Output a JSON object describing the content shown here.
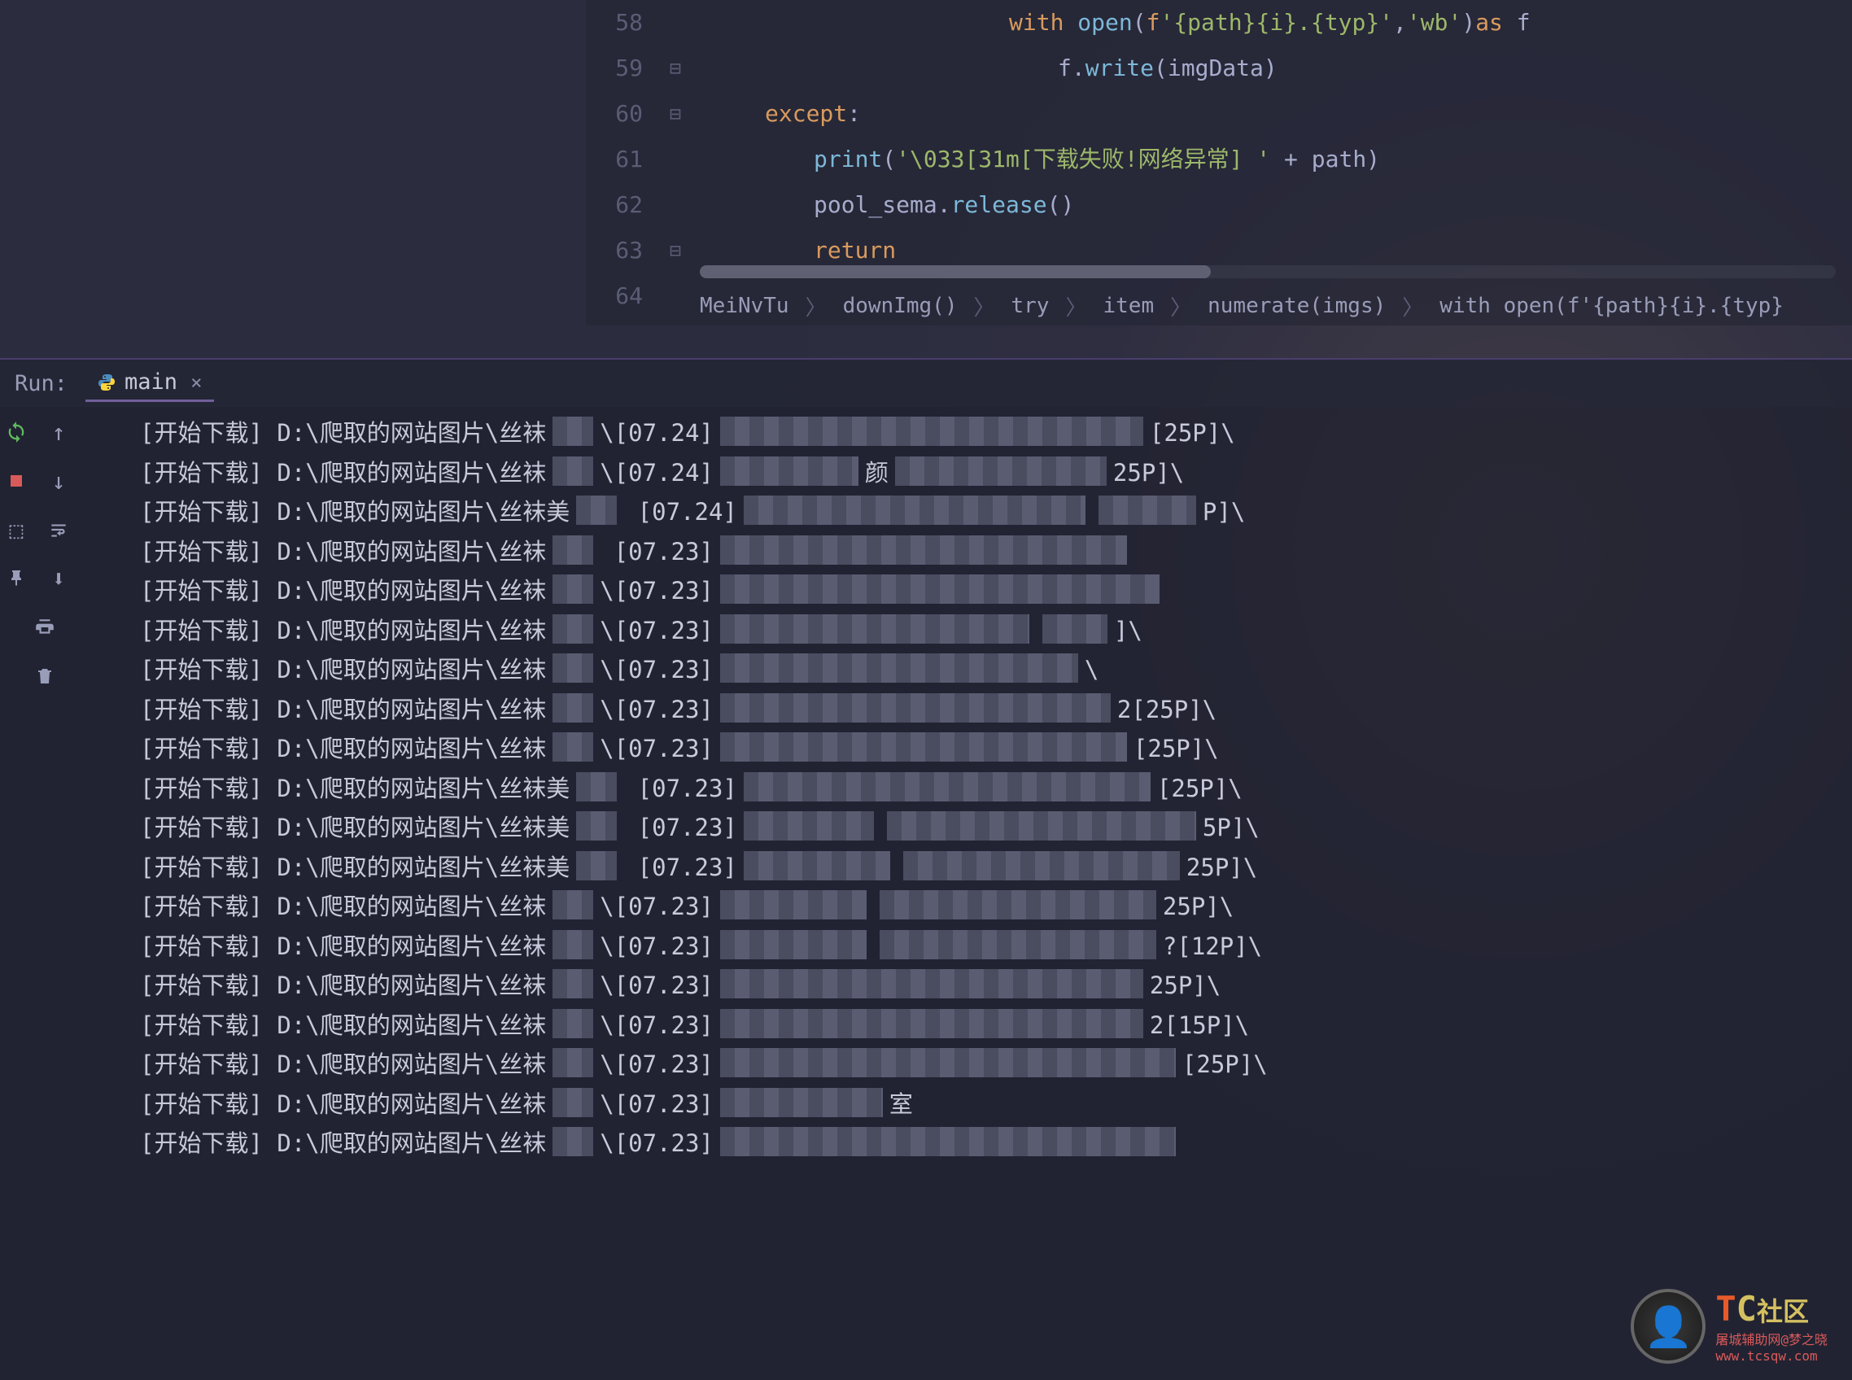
{
  "editor": {
    "lines": [
      {
        "num": "58",
        "fold": "",
        "indent": 380,
        "tokens": [
          [
            "kw",
            "with"
          ],
          [
            "op",
            " "
          ],
          [
            "fn",
            "open"
          ],
          [
            "op",
            "("
          ],
          [
            "kw",
            "f"
          ],
          [
            "str",
            "'{path}{i}.{typ}'"
          ],
          [
            "op",
            ","
          ],
          [
            "str",
            "'wb'"
          ],
          [
            "op",
            ")"
          ],
          [
            "kw",
            "as"
          ],
          [
            "op",
            " f"
          ]
        ]
      },
      {
        "num": "59",
        "fold": "⊟",
        "indent": 440,
        "tokens": [
          [
            "op",
            "f."
          ],
          [
            "fn",
            "write"
          ],
          [
            "op",
            "(imgData)"
          ]
        ]
      },
      {
        "num": "60",
        "fold": "⊟",
        "indent": 80,
        "tokens": [
          [
            "kw",
            "except"
          ],
          [
            "op",
            ":"
          ]
        ]
      },
      {
        "num": "61",
        "fold": "",
        "indent": 140,
        "tokens": [
          [
            "fn",
            "print"
          ],
          [
            "op",
            "("
          ],
          [
            "str",
            "'\\033[31m[下载失败!网络异常] '"
          ],
          [
            "op",
            " + path)"
          ]
        ]
      },
      {
        "num": "62",
        "fold": "",
        "indent": 140,
        "tokens": [
          [
            "op",
            "pool_sema."
          ],
          [
            "fn",
            "release"
          ],
          [
            "op",
            "()"
          ]
        ]
      },
      {
        "num": "63",
        "fold": "⊟",
        "indent": 140,
        "tokens": [
          [
            "kw",
            "return"
          ]
        ]
      },
      {
        "num": "64",
        "fold": "",
        "indent": 0,
        "tokens": []
      }
    ],
    "breadcrumb": [
      "MeiNvTu",
      "downImg()",
      "try",
      "item",
      "numerate(imgs)",
      "with open(f'{path}{i}.{typ}"
    ]
  },
  "run": {
    "label": "Run:",
    "tab": "main",
    "console": [
      {
        "prefix": "[开始下载] D:\\爬取的网站图片\\丝袜",
        "mid": "\\[07.24]",
        "cw1": 520,
        "cw2": 0,
        "suffix": "[25P]\\"
      },
      {
        "prefix": "[开始下载] D:\\爬取的网站图片\\丝袜",
        "mid": "\\[07.24]",
        "cw1": 170,
        "cw2": 260,
        "between": "颜",
        "suffix": "25P]\\"
      },
      {
        "prefix": "[开始下载] D:\\爬取的网站图片\\丝袜美",
        "mid": " [07.24]",
        "cw1": 420,
        "cw2": 120,
        "suffix": "P]\\"
      },
      {
        "prefix": "[开始下载] D:\\爬取的网站图片\\丝袜",
        "mid": " [07.23]",
        "cw1": 500,
        "cw2": 0,
        "suffix": ""
      },
      {
        "prefix": "[开始下载] D:\\爬取的网站图片\\丝袜",
        "mid": "\\[07.23]",
        "cw1": 540,
        "cw2": 0,
        "suffix": ""
      },
      {
        "prefix": "[开始下载] D:\\爬取的网站图片\\丝袜",
        "mid": "\\[07.23]",
        "cw1": 380,
        "cw2": 80,
        "suffix": "]\\"
      },
      {
        "prefix": "[开始下载] D:\\爬取的网站图片\\丝袜",
        "mid": "\\[07.23]",
        "cw1": 440,
        "cw2": 0,
        "suffix": "\\"
      },
      {
        "prefix": "[开始下载] D:\\爬取的网站图片\\丝袜",
        "mid": "\\[07.23]",
        "cw1": 480,
        "cw2": 0,
        "suffix": "2[25P]\\"
      },
      {
        "prefix": "[开始下载] D:\\爬取的网站图片\\丝袜",
        "mid": "\\[07.23]",
        "cw1": 500,
        "cw2": 0,
        "suffix": "[25P]\\"
      },
      {
        "prefix": "[开始下载] D:\\爬取的网站图片\\丝袜美",
        "mid": " [07.23]",
        "cw1": 500,
        "cw2": 0,
        "suffix": "[25P]\\"
      },
      {
        "prefix": "[开始下载] D:\\爬取的网站图片\\丝袜美",
        "mid": " [07.23]",
        "cw1": 160,
        "cw2": 380,
        "suffix": "5P]\\"
      },
      {
        "prefix": "[开始下载] D:\\爬取的网站图片\\丝袜美",
        "mid": " [07.23]",
        "cw1": 180,
        "cw2": 340,
        "suffix": "25P]\\"
      },
      {
        "prefix": "[开始下载] D:\\爬取的网站图片\\丝袜",
        "mid": "\\[07.23]",
        "cw1": 180,
        "cw2": 340,
        "suffix": "25P]\\"
      },
      {
        "prefix": "[开始下载] D:\\爬取的网站图片\\丝袜",
        "mid": "\\[07.23]",
        "cw1": 180,
        "cw2": 340,
        "suffix": "?[12P]\\"
      },
      {
        "prefix": "[开始下载] D:\\爬取的网站图片\\丝袜",
        "mid": "\\[07.23]",
        "cw1": 520,
        "cw2": 0,
        "suffix": "25P]\\"
      },
      {
        "prefix": "[开始下载] D:\\爬取的网站图片\\丝袜",
        "mid": "\\[07.23]",
        "cw1": 520,
        "cw2": 0,
        "suffix": "2[15P]\\"
      },
      {
        "prefix": "[开始下载] D:\\爬取的网站图片\\丝袜",
        "mid": "\\[07.23]",
        "cw1": 560,
        "cw2": 0,
        "suffix": "[25P]\\"
      },
      {
        "prefix": "[开始下载] D:\\爬取的网站图片\\丝袜",
        "mid": "\\[07.23]",
        "cw1": 200,
        "cw2": 0,
        "between": "室",
        "suffix": ""
      },
      {
        "prefix": "[开始下载] D:\\爬取的网站图片\\丝袜",
        "mid": "\\[07.23]",
        "cw1": 560,
        "cw2": 0,
        "suffix": ""
      }
    ]
  },
  "watermark": {
    "title1": "T",
    "title2": "C",
    "title3": "社区",
    "sub1": "屠城辅助网@梦之晓",
    "sub2": "www.tcsqw.com"
  }
}
